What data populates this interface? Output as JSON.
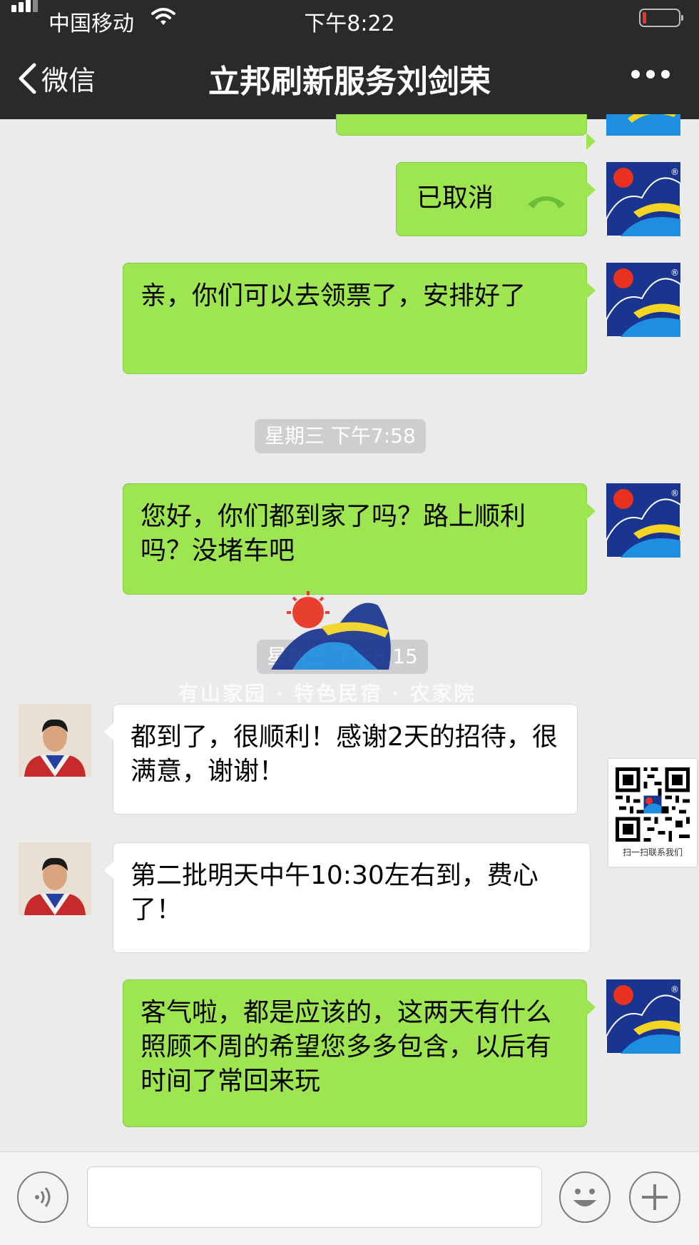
{
  "status_bar": {
    "carrier": "中国移动",
    "time": "下午8:22"
  },
  "nav": {
    "back_label": "微信",
    "title": "立邦刷新服务刘剑荣"
  },
  "messages": [
    {
      "from": "me",
      "text": "已取消"
    },
    {
      "from": "me",
      "text": "亲，你们可以去领票了，安排好了"
    },
    {
      "from": "me",
      "text": "您好，你们都到家了吗？路上顺利吗？没堵车吧"
    },
    {
      "from": "them",
      "text": " 都到了，很顺利！感谢2天的招待，很满意，谢谢！"
    },
    {
      "from": "them",
      "text": "第二批明天中午10:30左右到，费心了！"
    },
    {
      "from": "me",
      "text": "客气啦，都是应该的，这两天有什么照顾不周的希望您多多包含，以后有时间了常回来玩"
    }
  ],
  "timestamps": [
    "星期三 下午7:58",
    "星期三 下午8:15"
  ],
  "watermark": {
    "text": "有山家园 · 特色民宿 · 农家院"
  },
  "qr_card": {
    "caption": "扫一扫联系我们"
  },
  "colors": {
    "bubble_me": "#9de652",
    "bubble_them": "#ffffff",
    "nav_bg": "#2a2a2c",
    "chat_bg": "#ebebeb"
  },
  "icons": {
    "call": "phone-hangup-icon",
    "voice": "voice-icon",
    "emoji": "emoji-icon",
    "add": "add-icon",
    "more": "more-icon",
    "back": "chevron-left-icon"
  }
}
